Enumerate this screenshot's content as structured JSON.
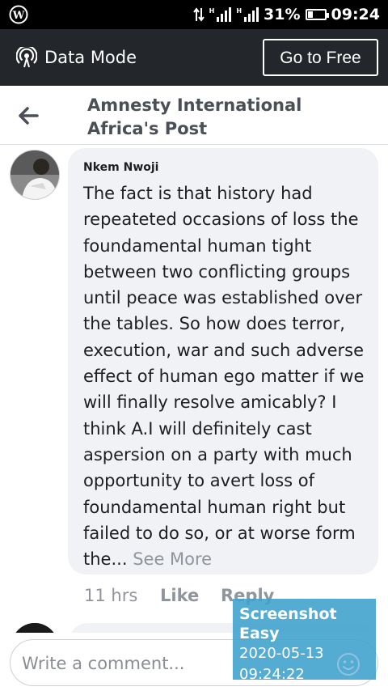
{
  "status_bar": {
    "battery": "31%",
    "time": "09:24",
    "network_1": "H",
    "network_2": "H",
    "battery_level": 0.31,
    "icons": [
      "wordpress-icon",
      "data-transfer-icon",
      "signal-icon",
      "battery-icon"
    ]
  },
  "data_mode_bar": {
    "label": "Data Mode",
    "button": "Go to Free",
    "icon": "broadcast-icon",
    "background": "#23272b"
  },
  "header": {
    "title_line1": "Amnesty International",
    "title_line2": "Africa's Post",
    "icon": "back-arrow-icon"
  },
  "comment": {
    "author": "Nkem Nwoji",
    "body": "The fact is that history had repeateted occasions of loss the foundamental human tight between two conflicting groups until peace was established over the tables. So how does terror, execution, war and such adverse effect of human ego matter if we will finally resolve amicably? I think A.I will definitely cast aspersion on a party with much opportunity to avert loss of foundamental human right  but failed to do so, or at worse form the...",
    "see_more": "See More",
    "time": "11 hrs",
    "like": "Like",
    "reply": "Reply",
    "bubble_color": "#f0f2f5"
  },
  "composer": {
    "placeholder": "Write a comment...",
    "icon": "emoji-icon"
  },
  "watermark": {
    "app": "Screenshot Easy",
    "date": "2020-05-13",
    "time": "09:24:22",
    "color": "#3ea0cd"
  }
}
